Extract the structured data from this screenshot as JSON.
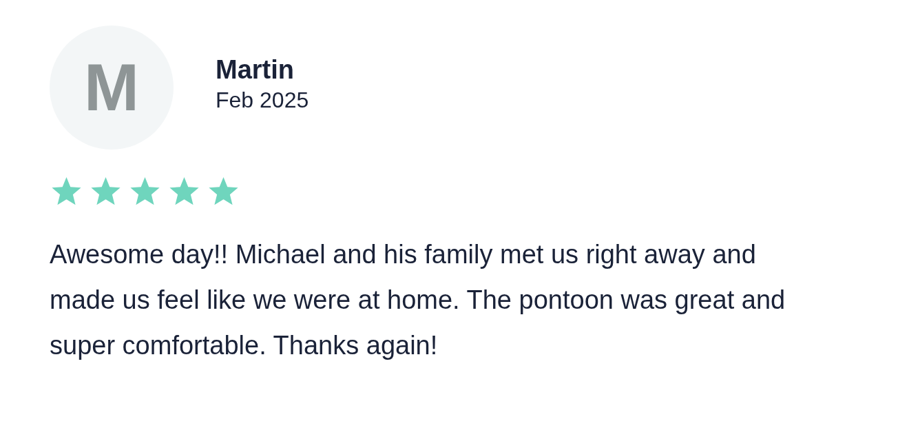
{
  "review": {
    "avatar_letter": "M",
    "name": "Martin",
    "date": "Feb 2025",
    "stars": 5,
    "text": "Awesome day!! Michael and his family met us right away and made us feel like we were at home. The pontoon was great and super comfortable. Thanks again!"
  }
}
